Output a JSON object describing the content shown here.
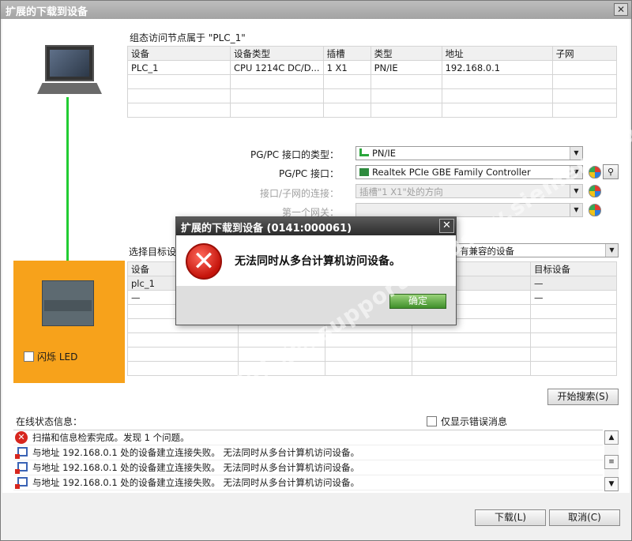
{
  "window": {
    "title": "扩展的下载到设备",
    "close_glyph": "✕"
  },
  "access_node": {
    "heading": "组态访问节点属于 \"PLC_1\"",
    "columns": [
      "设备",
      "设备类型",
      "插槽",
      "类型",
      "地址",
      "子网"
    ],
    "rows": [
      [
        "PLC_1",
        "CPU 1214C DC/D...",
        "1 X1",
        "PN/IE",
        "192.168.0.1",
        ""
      ]
    ]
  },
  "interface": {
    "type_label": "PG/PC 接口的类型：",
    "type_value": "PN/IE",
    "iface_label": "PG/PC 接口：",
    "iface_value": "Realtek PCIe GBE Family Controller",
    "conn_label": "接口/子网的连接：",
    "conn_value": "插槽\"1 X1\"处的方向",
    "gateway_label": "第一个网关：",
    "gateway_value": ""
  },
  "target": {
    "heading_prefix": "选择目标设",
    "filter_value": "有兼容的设备",
    "columns_left": [
      "设备"
    ],
    "columns_right": [
      "目标设备"
    ],
    "rows": [
      [
        "plc_1",
        ".1",
        "—"
      ],
      [
        "—",
        "",
        "—"
      ]
    ]
  },
  "left": {
    "flash_label": "闪烁 LED"
  },
  "search_button": "开始搜索(S)",
  "status": {
    "heading": "在线状态信息：",
    "only_errors_label": "仅显示错误消息",
    "messages": [
      "扫描和信息检索完成。发现 1 个问题。",
      "与地址 192.168.0.1 处的设备建立连接失败。 无法同时从多台计算机访问设备。",
      "与地址 192.168.0.1 处的设备建立连接失败。 无法同时从多台计算机访问设备。",
      "与地址 192.168.0.1 处的设备建立连接失败。 无法同时从多台计算机访问设备。"
    ]
  },
  "footer": {
    "load_button": "下载(L)",
    "cancel_button": "取消(C)"
  },
  "dialog": {
    "title": "扩展的下载到设备 (0141:000061)",
    "close_glyph": "✕",
    "error_glyph": "✕",
    "message": "无法同时从多台计算机访问设备。",
    "ok_button": "确定"
  },
  "watermark": "西门子工业 support.industry.siemens.com/cs",
  "colors": {
    "link_line": "#22cc33",
    "orange_panel": "#f7a21b",
    "error_red": "#d7261e"
  },
  "icons": [
    "laptop-icon",
    "plc-icon",
    "shield-icon",
    "flash-icon",
    "error-icon",
    "network-error-icon",
    "scroll-up-icon",
    "scroll-down-icon"
  ]
}
